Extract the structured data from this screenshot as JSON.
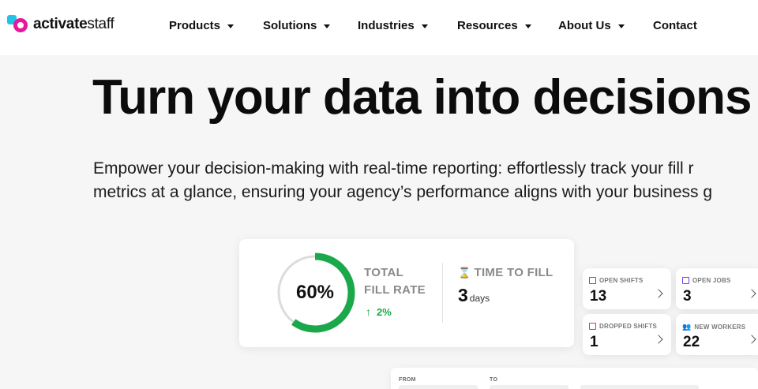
{
  "brand": {
    "name_bold": "activate",
    "name_light": "staff"
  },
  "nav": {
    "items": [
      {
        "label": "Products",
        "has_dropdown": true
      },
      {
        "label": "Solutions",
        "has_dropdown": true
      },
      {
        "label": "Industries",
        "has_dropdown": true
      },
      {
        "label": "Resources",
        "has_dropdown": true
      },
      {
        "label": "About Us",
        "has_dropdown": true
      },
      {
        "label": "Contact",
        "has_dropdown": false
      }
    ]
  },
  "hero": {
    "title": "Turn your data into decisions",
    "subtitle_line1": "Empower your decision-making with real-time reporting: effortlessly track your fill r",
    "subtitle_line2": "metrics at a glance, ensuring your agency’s performance aligns with your business g"
  },
  "dashboard": {
    "fill_rate": {
      "value": "60%",
      "fraction": 0.6,
      "label_line1": "TOTAL",
      "label_line2": "FILL RATE",
      "change": "2%",
      "change_color": "#1aa84a",
      "ring_color": "#1aa84a",
      "track_color": "#dcdcdc"
    },
    "time_to_fill": {
      "label": "TIME TO FILL",
      "value": "3",
      "unit": "days",
      "icon": "hourglass-icon"
    },
    "tiles": [
      {
        "label": "OPEN SHIFTS",
        "value": "13",
        "icon": "calendar-icon",
        "icon_color": "#7b3fe4"
      },
      {
        "label": "OPEN JOBS",
        "value": "3",
        "icon": "calendar-icon",
        "icon_color": "#7b3fe4"
      },
      {
        "label": "DROPPED SHIFTS",
        "value": "1",
        "icon": "calendar-x-icon",
        "icon_color": "#e5383b"
      },
      {
        "label": "NEW WORKERS",
        "value": "22",
        "icon": "users-icon",
        "icon_color": "#444444"
      }
    ],
    "filters": {
      "from_label": "FROM",
      "to_label": "TO"
    }
  },
  "colors": {
    "brand_cyan": "#22c3e6",
    "brand_magenta": "#e6199b",
    "accent_green": "#1aa84a"
  }
}
